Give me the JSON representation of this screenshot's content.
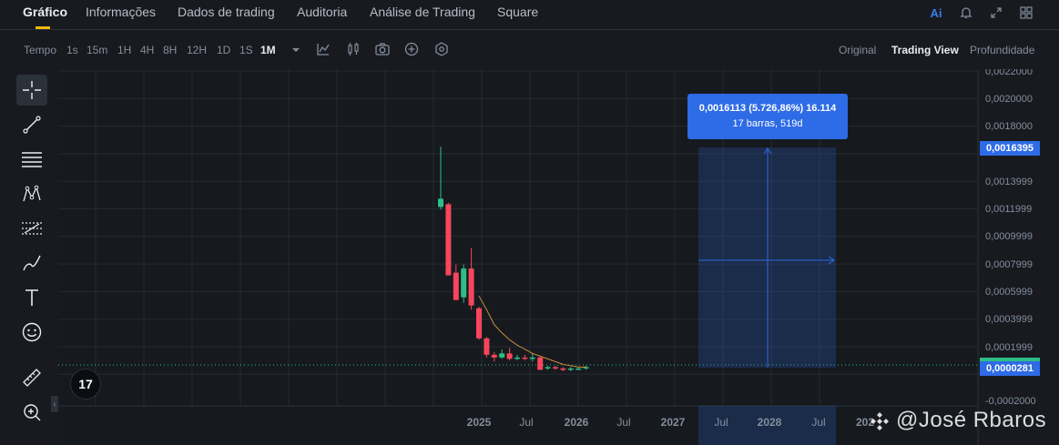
{
  "tabs": [
    {
      "label": "Gráfico",
      "active": true
    },
    {
      "label": "Informações"
    },
    {
      "label": "Dados de trading"
    },
    {
      "label": "Auditoria"
    },
    {
      "label": "Análise de Trading"
    },
    {
      "label": "Square"
    }
  ],
  "top_icons": {
    "ai": "Ai",
    "bell": "bell-icon",
    "expand": "expand-icon",
    "grid": "grid-icon"
  },
  "toolbar": {
    "tempo_label": "Tempo",
    "intervals": [
      "1s",
      "15m",
      "1H",
      "4H",
      "8H",
      "12H",
      "1D",
      "1S",
      "1M"
    ],
    "active_interval": "1M",
    "icons": [
      "chevron-down-icon",
      "indicator-icon",
      "candle-type-icon",
      "camera-icon",
      "add-icon",
      "settings-icon"
    ],
    "view_options": [
      "Original",
      "Trading View",
      "Profundidade"
    ],
    "active_view": "Trading View"
  },
  "left_tools": [
    "crosshair-icon",
    "trendline-icon",
    "horizontal-lines-icon",
    "pattern-icon",
    "fib-icon",
    "brush-icon",
    "text-icon",
    "emoji-icon",
    "ruler-icon",
    "zoom-in-icon"
  ],
  "colors": {
    "background": "#181a20",
    "up": "#2ebd85",
    "down": "#f6465d",
    "accent": "#f0b90b",
    "measure": "#2e6be6",
    "ma_line": "#c98a3c"
  },
  "measure": {
    "line1": "0,0016113 (5.726,86%) 16.114",
    "line2": "17 barras, 519d"
  },
  "price_axis": {
    "ticks": [
      "0,0022000",
      "0,0020000",
      "0,0018000",
      "0,0013999",
      "0,0011999",
      "0,0009999",
      "0,0007999",
      "0,0005999",
      "0,0003999",
      "0,0001999",
      "-0,0002000"
    ],
    "badge_measure": "0,0016395",
    "badge_last": "0,0000281"
  },
  "time_axis": {
    "labels": [
      "2025",
      "Jul",
      "2026",
      "Jul",
      "2027",
      "Jul",
      "2028",
      "Jul",
      "202"
    ]
  },
  "watermark": "@José Rbaros",
  "tv_logo": "17",
  "chart_data": {
    "type": "candlestick",
    "interval": "1M",
    "ylim": [
      -0.0002,
      0.0022
    ],
    "candles": [
      {
        "o": 0.0012,
        "h": 0.00164,
        "l": 0.00118,
        "c": 0.00126,
        "dir": "up"
      },
      {
        "o": 0.00122,
        "h": 0.00123,
        "l": 0.0007,
        "c": 0.0007,
        "dir": "down"
      },
      {
        "o": 0.00072,
        "h": 0.00078,
        "l": 0.00052,
        "c": 0.00052,
        "dir": "down"
      },
      {
        "o": 0.00054,
        "h": 0.00078,
        "l": 0.0005,
        "c": 0.00075,
        "dir": "up"
      },
      {
        "o": 0.00075,
        "h": 0.0009,
        "l": 0.00045,
        "c": 0.00048,
        "dir": "down"
      },
      {
        "o": 0.00046,
        "h": 0.00047,
        "l": 0.00023,
        "c": 0.00024,
        "dir": "down"
      },
      {
        "o": 0.00024,
        "h": 0.00025,
        "l": 0.0001,
        "c": 0.00012,
        "dir": "down"
      },
      {
        "o": 0.00012,
        "h": 0.00014,
        "l": 7e-05,
        "c": 0.0001,
        "dir": "down"
      },
      {
        "o": 0.0001,
        "h": 0.00016,
        "l": 9e-05,
        "c": 0.00013,
        "dir": "up"
      },
      {
        "o": 0.00013,
        "h": 0.00017,
        "l": 8e-05,
        "c": 9e-05,
        "dir": "down"
      },
      {
        "o": 9e-05,
        "h": 0.00012,
        "l": 8e-05,
        "c": 0.0001,
        "dir": "up"
      },
      {
        "o": 0.0001,
        "h": 0.00012,
        "l": 8e-05,
        "c": 9e-05,
        "dir": "down"
      },
      {
        "o": 9e-05,
        "h": 0.00013,
        "l": 7e-05,
        "c": 0.0001,
        "dir": "up"
      },
      {
        "o": 0.0001,
        "h": 0.00011,
        "l": 1e-05,
        "c": 1e-05,
        "dir": "down"
      },
      {
        "o": 2e-05,
        "h": 4e-05,
        "l": 1e-05,
        "c": 3e-05,
        "dir": "up"
      },
      {
        "o": 3e-05,
        "h": 4e-05,
        "l": 1e-05,
        "c": 2e-05,
        "dir": "down"
      },
      {
        "o": 2e-05,
        "h": 3e-05,
        "l": 0.0,
        "c": 1e-05,
        "dir": "down"
      },
      {
        "o": 1e-05,
        "h": 3e-05,
        "l": 0.0,
        "c": 2e-05,
        "dir": "up"
      },
      {
        "o": 2e-05,
        "h": 3e-05,
        "l": 1e-05,
        "c": 2e-05,
        "dir": "up"
      },
      {
        "o": 2e-05,
        "h": 4e-05,
        "l": 1e-05,
        "c": 3e-05,
        "dir": "up"
      }
    ],
    "ma": [
      null,
      null,
      null,
      null,
      null,
      0.00055,
      0.00045,
      0.00034,
      0.00028,
      0.00023,
      0.00019,
      0.00016,
      0.00013,
      0.00011,
      9e-05,
      7e-05,
      5e-05,
      4e-05,
      3e-05,
      3e-05
    ]
  }
}
